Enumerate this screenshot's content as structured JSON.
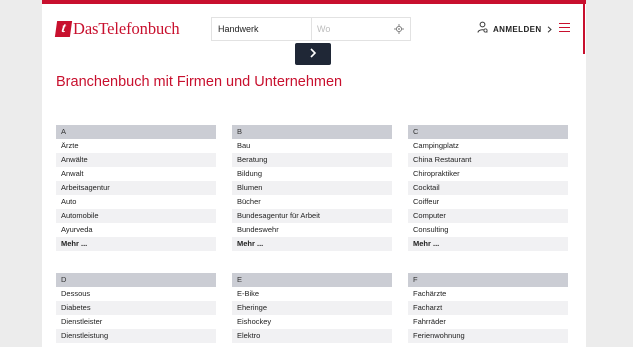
{
  "brand": {
    "logo_mark": "t",
    "logo_text": "DasTelefonbuch",
    "accent": "#c8102e"
  },
  "search": {
    "what_value": "Handwerk",
    "where_placeholder": "Wo",
    "locate_icon": "crosshair-icon",
    "submit_icon": "chevron-right-icon"
  },
  "header": {
    "login_label": "ANMELDEN",
    "login_icon": "user-icon",
    "menu_icon": "hamburger-icon"
  },
  "page": {
    "headline": "Branchenbuch mit Firmen und Unternehmen"
  },
  "columns_row1": [
    {
      "letter": "A",
      "items": [
        "Ärzte",
        "Anwälte",
        "Anwalt",
        "Arbeitsagentur",
        "Auto",
        "Automobile",
        "Ayurveda"
      ],
      "more": "Mehr ..."
    },
    {
      "letter": "B",
      "items": [
        "Bau",
        "Beratung",
        "Bildung",
        "Blumen",
        "Bücher",
        "Bundesagentur für Arbeit",
        "Bundeswehr"
      ],
      "more": "Mehr ..."
    },
    {
      "letter": "C",
      "items": [
        "Campingplatz",
        "China Restaurant",
        "Chiropraktiker",
        "Cocktail",
        "Coiffeur",
        "Computer",
        "Consulting"
      ],
      "more": "Mehr ..."
    }
  ],
  "columns_row2": [
    {
      "letter": "D",
      "items": [
        "Dessous",
        "Diabetes",
        "Dienstleister",
        "Dienstleistung"
      ]
    },
    {
      "letter": "E",
      "items": [
        "E-Bike",
        "Eheringe",
        "Eishockey",
        "Elektro"
      ]
    },
    {
      "letter": "F",
      "items": [
        "Fachärzte",
        "Facharzt",
        "Fahrräder",
        "Ferienwohnung"
      ]
    }
  ]
}
